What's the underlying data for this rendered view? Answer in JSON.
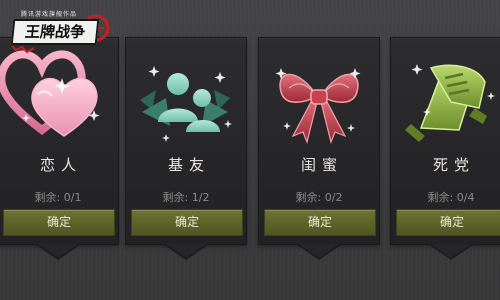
{
  "logo": {
    "top_text": "腾讯游戏旗舰作品",
    "title": "王牌战争"
  },
  "cards": [
    {
      "name": "恋人",
      "remain_label": "剩余: 0/1",
      "button": "确定",
      "icon": "hearts-icon",
      "color": "#e58aa8"
    },
    {
      "name": "基友",
      "remain_label": "剩余: 1/2",
      "button": "确定",
      "icon": "friends-icon",
      "color": "#8bd3bd"
    },
    {
      "name": "闺蜜",
      "remain_label": "剩余: 0/2",
      "button": "确定",
      "icon": "bow-icon",
      "color": "#c34450"
    },
    {
      "name": "死党",
      "remain_label": "剩余: 0/4",
      "button": "确定",
      "icon": "handshake-icon",
      "color": "#8eb04a"
    }
  ]
}
